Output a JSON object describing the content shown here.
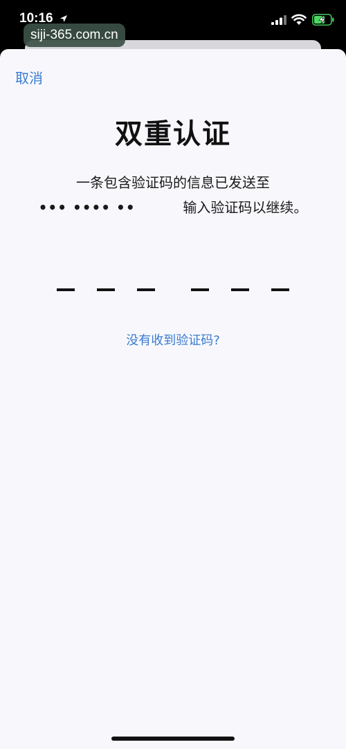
{
  "status_bar": {
    "time": "10:16",
    "icons": [
      "location-icon",
      "signal-icon",
      "wifi-icon",
      "battery-charging-icon"
    ]
  },
  "watermark": "siji-365.com.cn",
  "nav": {
    "cancel_label": "取消"
  },
  "title": "双重认证",
  "message": {
    "line1": "一条包含验证码的信息已发送至",
    "masked_number": "••• •••• ••",
    "line2_suffix": "输入验证码以继续。"
  },
  "code_input": {
    "slots": 6,
    "group_size": 3
  },
  "resend_link": "没有收到验证码?",
  "colors": {
    "accent": "#3a7bd0",
    "sheet_background": "#f8f8fc",
    "battery_charging": "#4cd964"
  }
}
